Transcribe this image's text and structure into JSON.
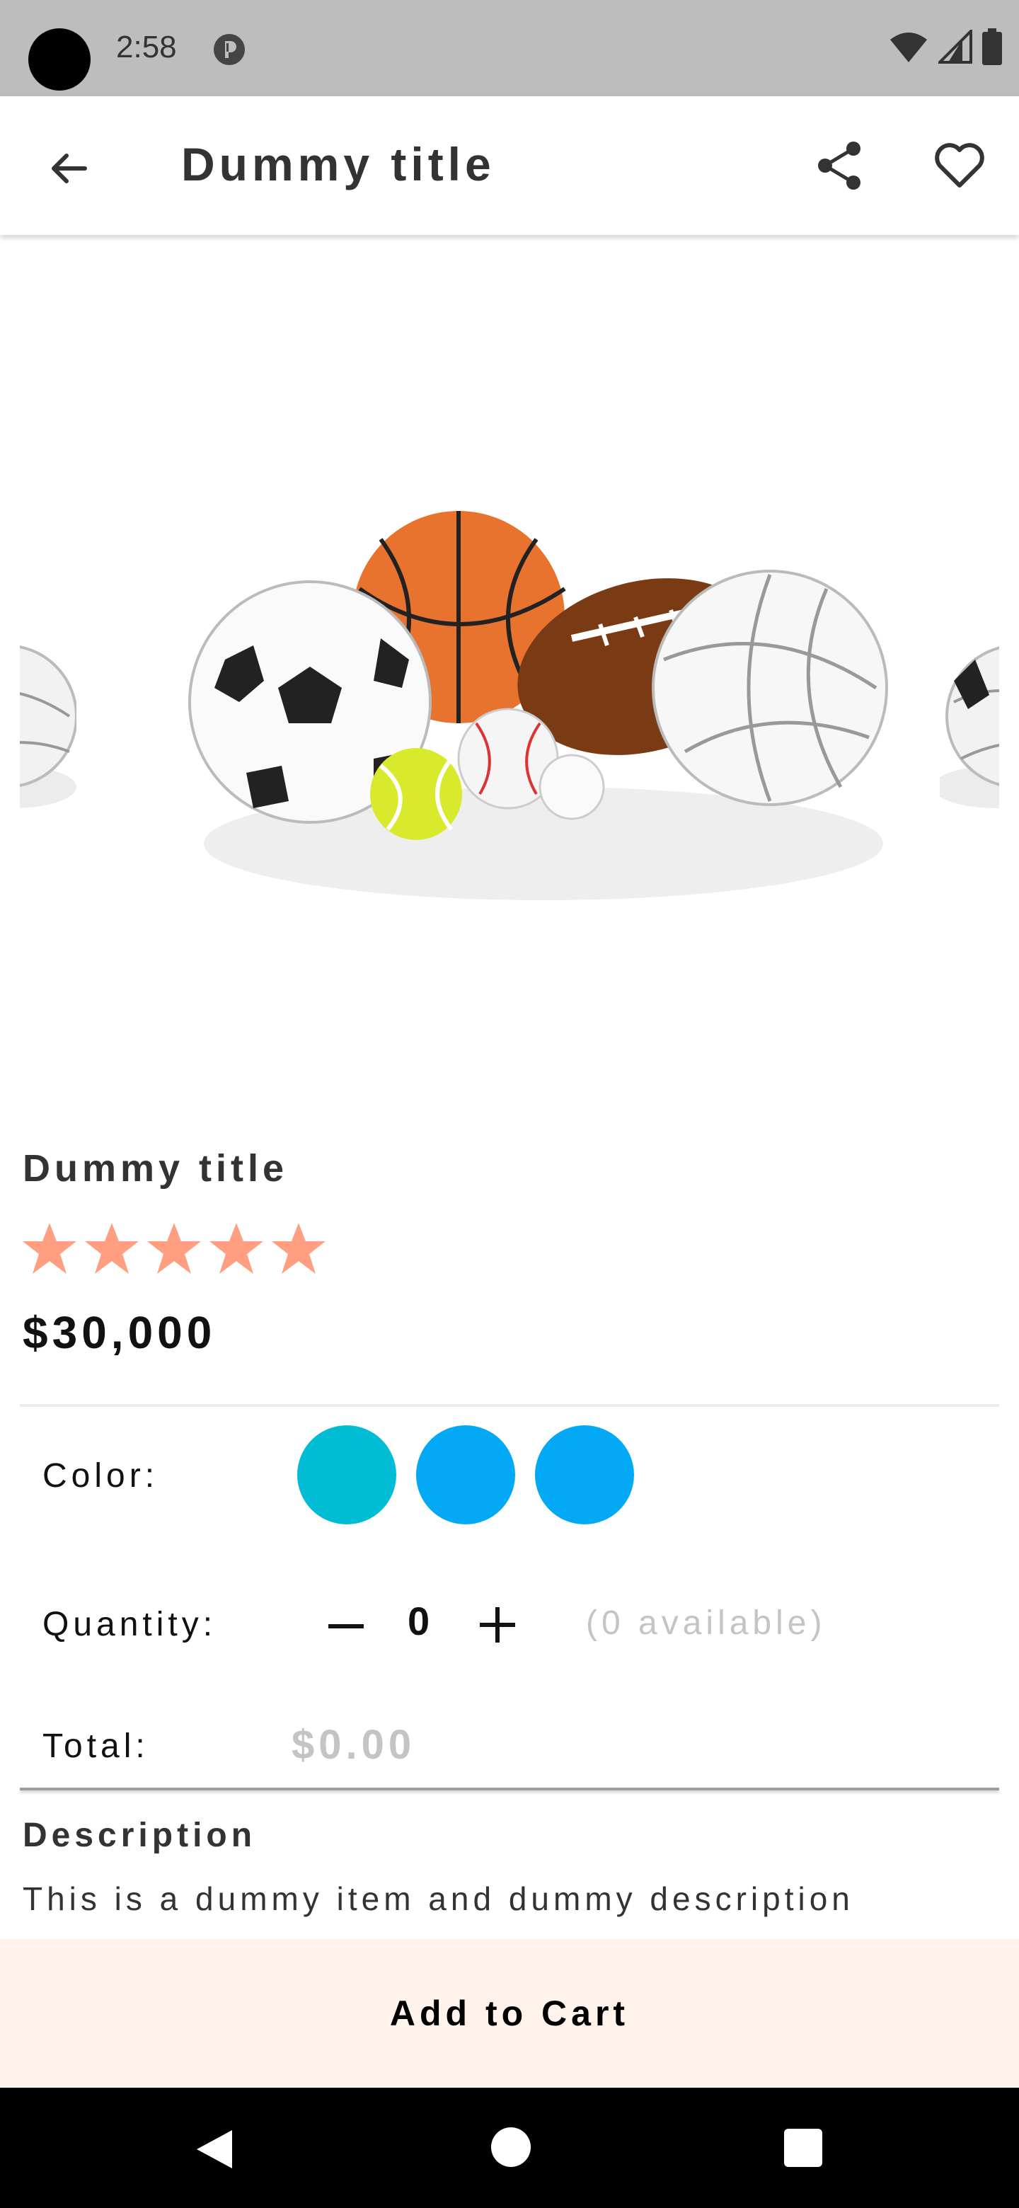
{
  "status_bar": {
    "time": "2:58",
    "icons": [
      "camera-cutout",
      "notification-icon",
      "wifi-icon",
      "signal-icon",
      "battery-icon"
    ]
  },
  "app_bar": {
    "title": "Dummy title",
    "icons": [
      "back-arrow-icon",
      "share-icon",
      "heart-icon"
    ]
  },
  "product": {
    "title": "Dummy title",
    "rating": 5,
    "rating_max": 5,
    "star_color": "#FF9E80",
    "price": "$30,000",
    "image": "sports-balls-image"
  },
  "color": {
    "label": "Color:",
    "swatches": [
      "#00BCD4",
      "#03A9F4",
      "#03A9F4"
    ]
  },
  "quantity": {
    "label": "Quantity:",
    "value": "0",
    "available": "(0 available)",
    "icons": [
      "minus-icon",
      "plus-icon"
    ]
  },
  "total": {
    "label": "Total:",
    "value": "$0.00"
  },
  "description": {
    "heading": "Description",
    "text": "This is a dummy item and dummy description"
  },
  "cart": {
    "button_label": "Add to Cart",
    "background": "#FFF3EC"
  },
  "nav_bar": {
    "icons": [
      "nav-back-icon",
      "nav-home-icon",
      "nav-recents-icon"
    ]
  }
}
